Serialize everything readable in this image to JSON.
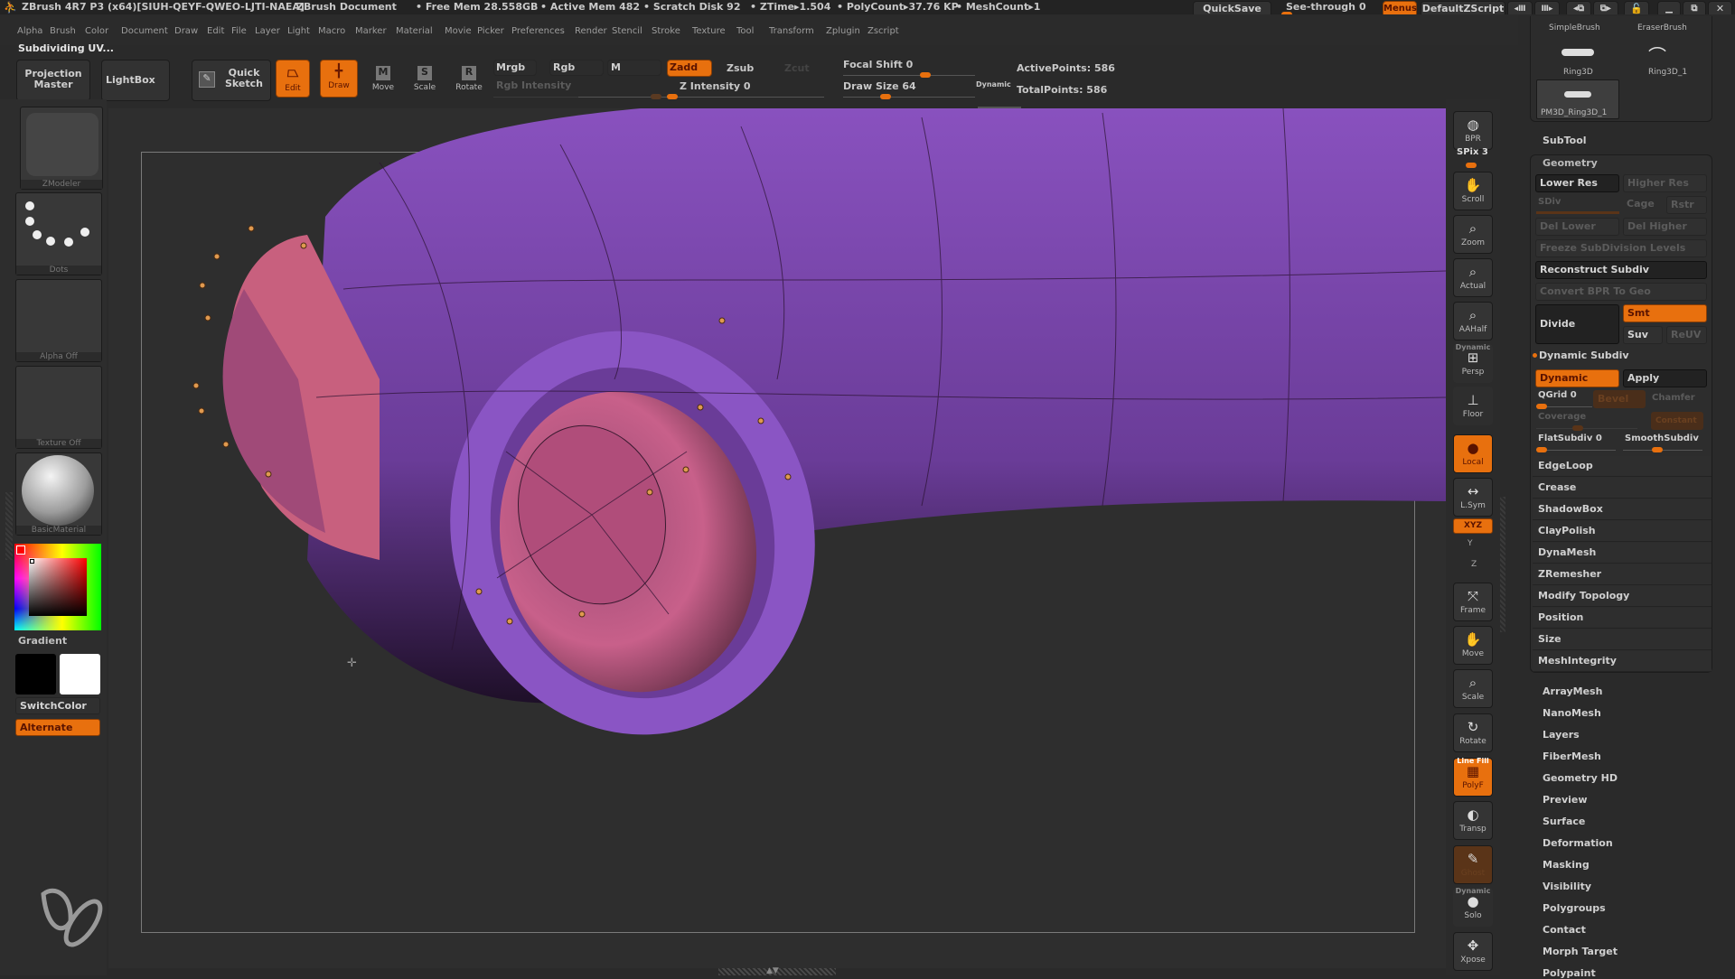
{
  "titlebar": {
    "app": "ZBrush 4R7 P3 (x64)[SIUH-QEYF-QWEO-LJTI-NAEA]",
    "document": "ZBrush Document",
    "free_mem": "• Free Mem 28.558GB",
    "active_mem": "• Active Mem 482",
    "scratch_disk": "• Scratch Disk 92",
    "ztime": "• ZTime▸1.504",
    "polycount": "• PolyCount▸37.76 KP",
    "meshcount": "• MeshCount▸1",
    "quicksave": "QuickSave",
    "see_through_label": "See-through",
    "see_through_value": "0",
    "menus": "Menus",
    "default_zscript": "DefaultZScript"
  },
  "menubar": [
    "Alpha",
    "Brush",
    "Color",
    "Document",
    "Draw",
    "Edit",
    "File",
    "Layer",
    "Light",
    "Macro",
    "Marker",
    "Material",
    "Movie",
    "Picker",
    "Preferences",
    "Render",
    "Stencil",
    "Stroke",
    "Texture",
    "Tool",
    "Transform",
    "Zplugin",
    "Zscript"
  ],
  "status": "Subdividing UV...",
  "toolbar": {
    "projection_master": "Projection Master",
    "lightbox": "LightBox",
    "quick_sketch": "Quick Sketch",
    "edit": "Edit",
    "draw": "Draw",
    "move": "Move",
    "scale": "Scale",
    "rotate": "Rotate",
    "mrgb": "Mrgb",
    "rgb": "Rgb",
    "m": "M",
    "rgb_intensity": "Rgb Intensity",
    "zadd": "Zadd",
    "zsub": "Zsub",
    "zcut": "Zcut",
    "z_intensity": "Z Intensity 0",
    "focal_shift": "Focal Shift 0",
    "draw_size": "Draw Size 64",
    "dynamic": "Dynamic",
    "active_points": "ActivePoints: 586",
    "total_points": "TotalPoints: 586"
  },
  "left_shelf": {
    "brush": "ZModeler",
    "stroke": "Dots",
    "alpha": "Alpha Off",
    "texture": "Texture Off",
    "material": "BasicMaterial",
    "gradient": "Gradient",
    "switch_color": "SwitchColor",
    "alternate": "Alternate",
    "colors": {
      "main": "#ff0000",
      "primary_swatch": "#000000",
      "secondary_swatch": "#ffffff"
    }
  },
  "right_shelf": [
    {
      "id": "bpr",
      "label": "BPR",
      "icon": "◍"
    },
    {
      "id": "spix",
      "label": "SPix 3"
    },
    {
      "id": "scroll",
      "label": "Scroll",
      "icon": "✋"
    },
    {
      "id": "zoom",
      "label": "Zoom",
      "icon": "⌕"
    },
    {
      "id": "actual",
      "label": "Actual",
      "icon": "⌕"
    },
    {
      "id": "aahalf",
      "label": "AAHalf",
      "icon": "⌕"
    },
    {
      "id": "persp",
      "label": "Persp",
      "top": "Dynamic",
      "icon": "⊞"
    },
    {
      "id": "floor",
      "label": "Floor",
      "icon": "⊥"
    },
    {
      "id": "local",
      "label": "Local",
      "icon": "●"
    },
    {
      "id": "lsym",
      "label": "L.Sym",
      "icon": "↔"
    },
    {
      "id": "xyz",
      "label": "XYZ"
    },
    {
      "id": "y",
      "label": "Y"
    },
    {
      "id": "z",
      "label": "Z"
    },
    {
      "id": "frame",
      "label": "Frame",
      "icon": "⤧"
    },
    {
      "id": "move",
      "label": "Move",
      "icon": "✋"
    },
    {
      "id": "scale",
      "label": "Scale",
      "icon": "⌕"
    },
    {
      "id": "rotate",
      "label": "Rotate",
      "icon": "↻"
    },
    {
      "id": "polyf",
      "label": "PolyF",
      "top": "Line Fill",
      "icon": "▦"
    },
    {
      "id": "transp",
      "label": "Transp",
      "icon": "◐"
    },
    {
      "id": "ghost",
      "label": "Ghost",
      "icon": "✎"
    },
    {
      "id": "solo",
      "label": "Solo",
      "top": "Dynamic",
      "icon": "●"
    },
    {
      "id": "xpose",
      "label": "Xpose",
      "icon": "✥"
    }
  ],
  "tool_palette": {
    "items": [
      "SimpleBrush",
      "EraserBrush",
      "Ring3D",
      "Ring3D_1",
      "PM3D_Ring3D_1"
    ],
    "subtool": "SubTool",
    "geometry": "Geometry",
    "lower_res": "Lower Res",
    "higher_res": "Higher Res",
    "sdiv": "SDiv",
    "cage": "Cage",
    "rstr": "Rstr",
    "del_lower": "Del Lower",
    "del_higher": "Del Higher",
    "freeze": "Freeze SubDivision Levels",
    "reconstruct": "Reconstruct Subdiv",
    "convert_bpr": "Convert BPR To Geo",
    "divide": "Divide",
    "smt": "Smt",
    "suv": "Suv",
    "reuv": "ReUV",
    "dynamic_subdiv": "Dynamic Subdiv",
    "dynamic": "Dynamic",
    "apply": "Apply",
    "qgrid": "QGrid 0",
    "bevel": "Bevel",
    "chamfer": "Chamfer",
    "coverage": "Coverage",
    "constant": "Constant",
    "flatsubdiv": "FlatSubdiv 0",
    "smoothsubdiv": "SmoothSubdiv",
    "geometry_sections": [
      "EdgeLoop",
      "Crease",
      "ShadowBox",
      "ClayPolish",
      "DynaMesh",
      "ZRemesher",
      "Modify Topology",
      "Position",
      "Size",
      "MeshIntegrity"
    ],
    "tool_sections": [
      "ArrayMesh",
      "NanoMesh",
      "Layers",
      "FiberMesh",
      "Geometry HD",
      "Preview",
      "Surface",
      "Deformation",
      "Masking",
      "Visibility",
      "Polygroups",
      "Contact",
      "Morph Target",
      "Polypaint"
    ]
  },
  "colors": {
    "accent": "#e8700e",
    "mesh_purple": "#7a4aa8",
    "mesh_pink": "#c86078"
  }
}
